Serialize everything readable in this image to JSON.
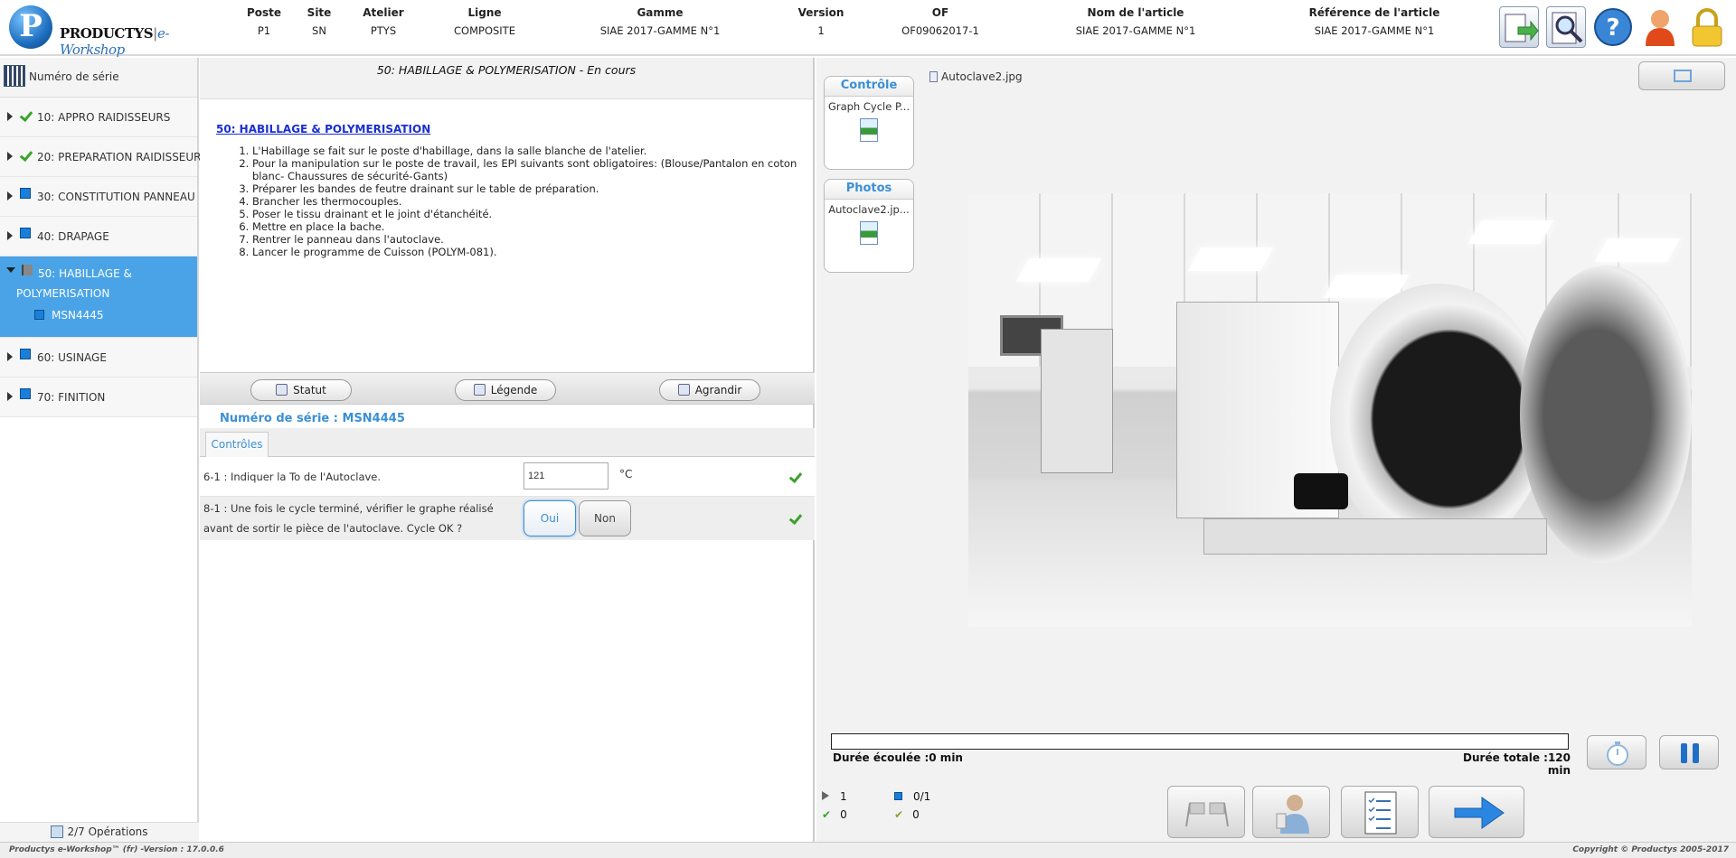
{
  "header": {
    "logo_letter": "P",
    "logo_name": "PRODUCTYS",
    "logo_sub": "e-Workshop",
    "columns": [
      {
        "label": "Poste",
        "value": "P1"
      },
      {
        "label": "Site",
        "value": "SN"
      },
      {
        "label": "Atelier",
        "value": "PTYS"
      },
      {
        "label": "Ligne",
        "value": "COMPOSITE"
      },
      {
        "label": "Gamme",
        "value": "SIAE 2017-GAMME N°1"
      },
      {
        "label": "Version",
        "value": "1"
      },
      {
        "label": "OF",
        "value": "OF09062017-1"
      },
      {
        "label": "Nom de l'article",
        "value": "SIAE 2017-GAMME N°1"
      },
      {
        "label": "Référence de l'article",
        "value": "SIAE 2017-GAMME N°1"
      }
    ],
    "icons": [
      "export-icon",
      "search-document-icon",
      "help-icon",
      "user-icon",
      "lock-icon"
    ]
  },
  "left": {
    "serial_label": "Numéro de série",
    "operations": [
      {
        "label": "10: APPRO RAIDISSEURS",
        "status": "done"
      },
      {
        "label": "20: PREPARATION RAIDISSEURS",
        "status": "done"
      },
      {
        "label": "30: CONSTITUTION PANNEAU",
        "status": "todo"
      },
      {
        "label": "40: DRAPAGE",
        "status": "todo"
      }
    ],
    "active": {
      "label": "50: HABILLAGE & POLYMERISATION",
      "child": "MSN4445"
    },
    "operations_after": [
      {
        "label": "60: USINAGE",
        "status": "todo"
      },
      {
        "label": "70: FINITION",
        "status": "todo"
      }
    ],
    "footer": "2/7 Opérations"
  },
  "middle": {
    "title": "50: HABILLAGE & POLYMERISATION - En cours",
    "instr_title": "50: HABILLAGE & POLYMERISATION",
    "steps": [
      "L'Habillage se fait sur le poste d'habillage, dans la salle blanche de l'atelier.",
      "Pour la manipulation sur le poste de travail, les EPI suivants sont obligatoires: (Blouse/Pantalon en coton blanc- Chaussures de sécurité-Gants)",
      "Préparer les bandes de feutre drainant sur le table de préparation.",
      "Brancher les thermocouples.",
      "Poser le tissu drainant et le joint d'étanchéité.",
      "Mettre en place la bache.",
      "Rentrer le panneau dans l'autoclave.",
      "Lancer le programme de Cuisson (POLYM-081)."
    ],
    "buttons": {
      "statut": "Statut",
      "legende": "Légende",
      "agrandir": "Agrandir"
    },
    "serial": "Numéro de série : MSN4445",
    "tab": "Contrôles",
    "controls": {
      "q1": "6-1 : Indiquer la To de l'Autoclave.",
      "q1_value": "121",
      "q1_unit": "°C",
      "q2_line1": "8-1 : Une fois le cycle terminé, vérifier le graphe réalisé",
      "q2_line2": "avant de sortir le pièce de l'autoclave. Cycle OK ?",
      "yes": "Oui",
      "no": "Non"
    }
  },
  "right": {
    "card1_title": "Contrôle",
    "card1_item": "Graph Cycle P...",
    "card2_title": "Photos",
    "card2_item": "Autoclave2.jp...",
    "file_name": "Autoclave2.jpg",
    "elapsed": "Durée écoulée :0 min",
    "total": "Durée totale :120 min",
    "progress": 0,
    "stats": {
      "s1": "1",
      "s2": "0/1",
      "s3": "0",
      "s4": "0"
    }
  },
  "status": {
    "left": "Productys e-Workshop™ (fr) -Version : 17.0.0.6",
    "right": "Copyright © Productys 2005-2017"
  }
}
